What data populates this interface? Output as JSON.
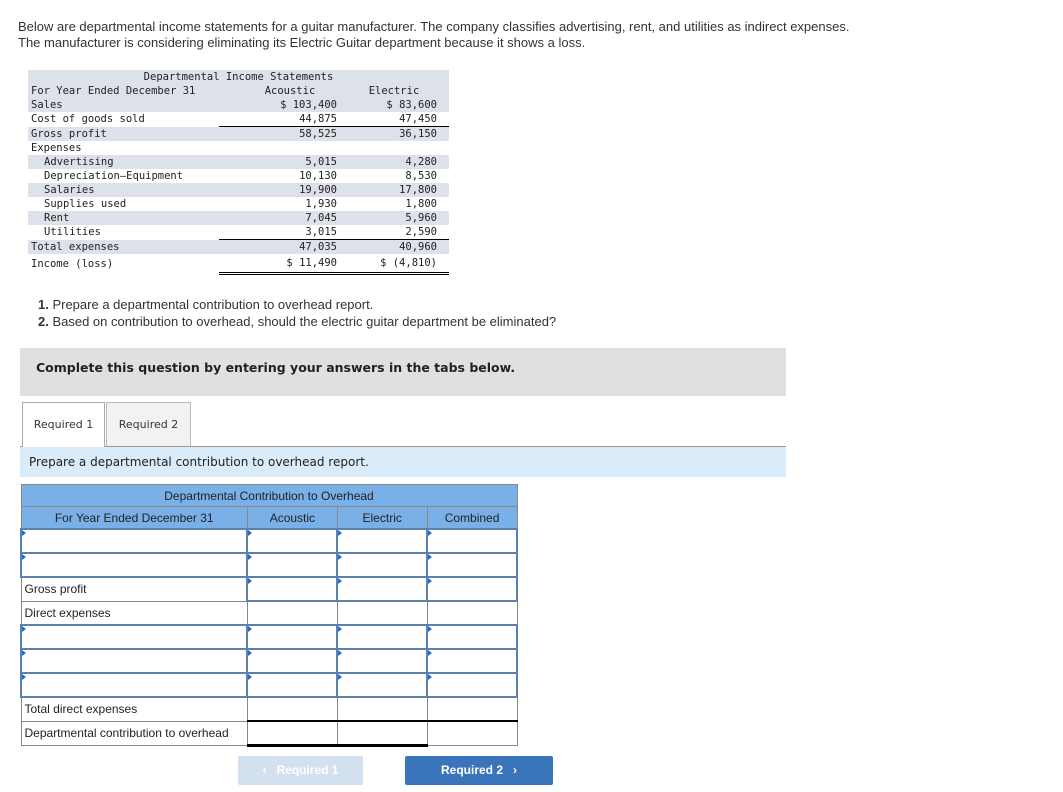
{
  "intro": "Below are departmental income statements for a guitar manufacturer. The company classifies advertising, rent, and utilities as indirect expenses. The manufacturer is considering eliminating its Electric Guitar department because it shows a loss.",
  "statement": {
    "title": "Departmental Income Statements",
    "period": "For Year Ended December 31",
    "col1": "Acoustic",
    "col2": "Electric",
    "rows": [
      {
        "label": "Sales",
        "v1": "$ 103,400",
        "v2": "$ 83,600"
      },
      {
        "label": "Cost of goods sold",
        "v1": "44,875",
        "v2": "47,450"
      },
      {
        "label": "Gross profit",
        "v1": "58,525",
        "v2": "36,150"
      },
      {
        "label": "Expenses",
        "v1": "",
        "v2": ""
      },
      {
        "label": "Advertising",
        "v1": "5,015",
        "v2": "4,280"
      },
      {
        "label": "Depreciation—Equipment",
        "v1": "10,130",
        "v2": "8,530"
      },
      {
        "label": "Salaries",
        "v1": "19,900",
        "v2": "17,800"
      },
      {
        "label": "Supplies used",
        "v1": "1,930",
        "v2": "1,800"
      },
      {
        "label": "Rent",
        "v1": "7,045",
        "v2": "5,960"
      },
      {
        "label": "Utilities",
        "v1": "3,015",
        "v2": "2,590"
      },
      {
        "label": "Total expenses",
        "v1": "47,035",
        "v2": "40,960"
      },
      {
        "label": "Income (loss)",
        "v1": "$ 11,490",
        "v2": "$ (4,810)"
      }
    ]
  },
  "questions": [
    {
      "num": "1.",
      "text": " Prepare a departmental contribution to overhead report."
    },
    {
      "num": "2.",
      "text": " Based on contribution to overhead, should the electric guitar department be eliminated?"
    }
  ],
  "banner": "Complete this question by entering your answers in the tabs below.",
  "tabs": [
    {
      "label": "Required 1",
      "active": true
    },
    {
      "label": "Required 2",
      "active": false
    }
  ],
  "instruction": "Prepare a departmental contribution to overhead report.",
  "report": {
    "title": "Departmental Contribution to Overhead",
    "headers": [
      "For Year Ended December 31",
      "Acoustic",
      "Electric",
      "Combined"
    ],
    "labels": {
      "gross_profit": "Gross profit",
      "direct_expenses": "Direct expenses",
      "total_direct": "Total direct expenses",
      "contribution": "Departmental contribution to overhead"
    },
    "inputs": {
      "row1": [
        "",
        "",
        "",
        ""
      ],
      "row2": [
        "",
        "",
        "",
        ""
      ],
      "gross_profit": [
        "",
        "",
        ""
      ],
      "direct1": [
        "",
        "",
        "",
        ""
      ],
      "direct2": [
        "",
        "",
        "",
        ""
      ],
      "direct3": [
        "",
        "",
        "",
        ""
      ]
    }
  },
  "nav": {
    "prev_label": "Required 1",
    "next_label": "Required 2",
    "prev_icon": "chevron-left-icon",
    "next_icon": "chevron-right-icon"
  }
}
